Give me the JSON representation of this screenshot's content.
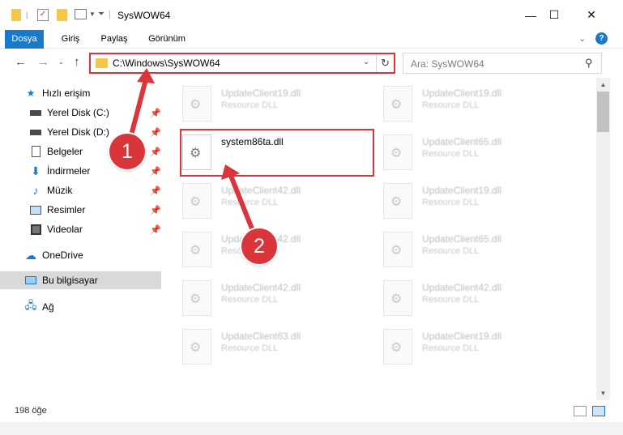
{
  "window": {
    "title": "SysWOW64",
    "minimize_glyph": "—",
    "maximize_glyph": "☐",
    "close_glyph": "✕"
  },
  "ribbon": {
    "tabs": [
      "Dosya",
      "Giriş",
      "Paylaş",
      "Görünüm"
    ],
    "help_glyph": "?"
  },
  "address": {
    "path": "C:\\Windows\\SysWOW64",
    "search_placeholder": "Ara: SysWOW64"
  },
  "sidebar": {
    "items": [
      {
        "label": "Hızlı erişim",
        "icon": "star-icon"
      },
      {
        "label": "Yerel Disk (C:)",
        "icon": "drive-icon",
        "pinned": true
      },
      {
        "label": "Yerel Disk (D:)",
        "icon": "drive-icon",
        "pinned": true
      },
      {
        "label": "Belgeler",
        "icon": "documents-icon",
        "pinned": true
      },
      {
        "label": "İndirmeler",
        "icon": "download-icon",
        "pinned": true
      },
      {
        "label": "Müzik",
        "icon": "music-icon",
        "pinned": true
      },
      {
        "label": "Resimler",
        "icon": "pictures-icon",
        "pinned": true
      },
      {
        "label": "Videolar",
        "icon": "videos-icon",
        "pinned": true
      },
      {
        "label": "OneDrive",
        "icon": "cloud-icon"
      },
      {
        "label": "Bu bilgisayar",
        "icon": "computer-icon",
        "selected": true
      },
      {
        "label": "Ağ",
        "icon": "network-icon"
      }
    ]
  },
  "files": [
    {
      "name": "UpdateClient19.dll",
      "type": "Resource DLL"
    },
    {
      "name": "UpdateClient19.dll",
      "type": "Resource DLL"
    },
    {
      "name": "system86ta.dll",
      "type": "",
      "highlighted": true
    },
    {
      "name": "UpdateClient65.dll",
      "type": "Resource DLL"
    },
    {
      "name": "UpdateClient42.dll",
      "type": "Resource DLL"
    },
    {
      "name": "UpdateClient19.dll",
      "type": "Resource DLL"
    },
    {
      "name": "UpdateClient42.dll",
      "type": "Resource DLL"
    },
    {
      "name": "UpdateClient65.dll",
      "type": "Resource DLL"
    },
    {
      "name": "UpdateClient42.dll",
      "type": "Resource DLL"
    },
    {
      "name": "UpdateClient42.dll",
      "type": "Resource DLL"
    },
    {
      "name": "UpdateClient63.dll",
      "type": "Resource DLL"
    },
    {
      "name": "UpdateClient19.dll",
      "type": "Resource DLL"
    }
  ],
  "status": {
    "item_count": "198 öğe"
  },
  "callouts": [
    "1",
    "2"
  ],
  "colors": {
    "accent": "#1979ca",
    "highlight_red": "#d9353b"
  }
}
